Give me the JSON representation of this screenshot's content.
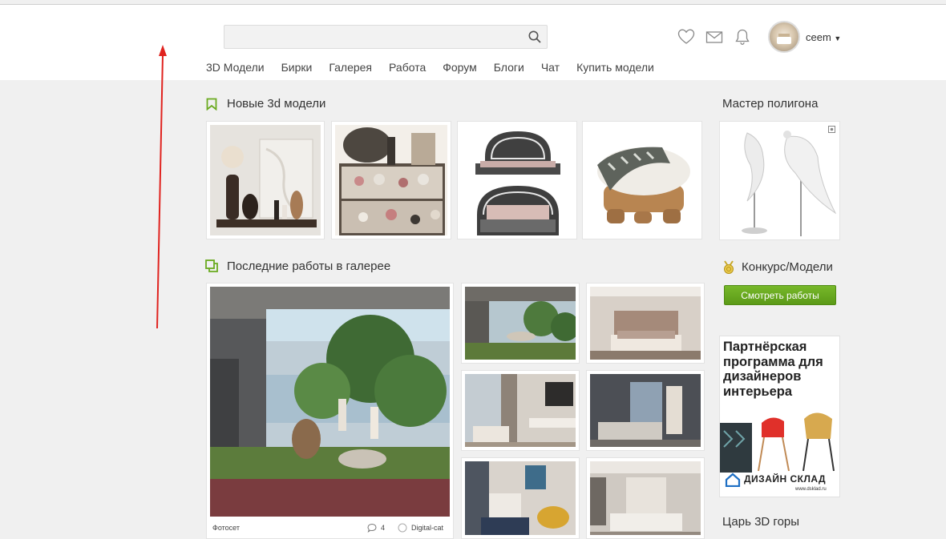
{
  "header": {
    "search": {
      "value": "",
      "placeholder": ""
    },
    "username": "ceem",
    "icons": [
      "heart-icon",
      "mail-icon",
      "bell-icon"
    ]
  },
  "nav": {
    "items": [
      "3D Модели",
      "Бирки",
      "Галерея",
      "Работа",
      "Форум",
      "Блоги",
      "Чат",
      "Купить модели"
    ]
  },
  "new_models": {
    "title": "Новые 3d модели"
  },
  "gallery": {
    "title": "Последние работы в галерее",
    "featured": {
      "category": "Фотосет",
      "comments": "4",
      "author": "Digital-cat"
    }
  },
  "sidebar": {
    "polygon_master_title": "Мастер полигона",
    "contest_title": "Конкурс/Модели",
    "view_works_label": "Смотреть работы",
    "ad": {
      "text": "Партнёрская программа для дизайнеров интерьера",
      "brand": "ДИЗАЙН СКЛАД",
      "url": "www.dsklad.ru"
    },
    "king_title": "Царь 3D горы"
  },
  "colors": {
    "accent_green": "#6aaa1f",
    "annotation_arrow": "#e0231f"
  }
}
